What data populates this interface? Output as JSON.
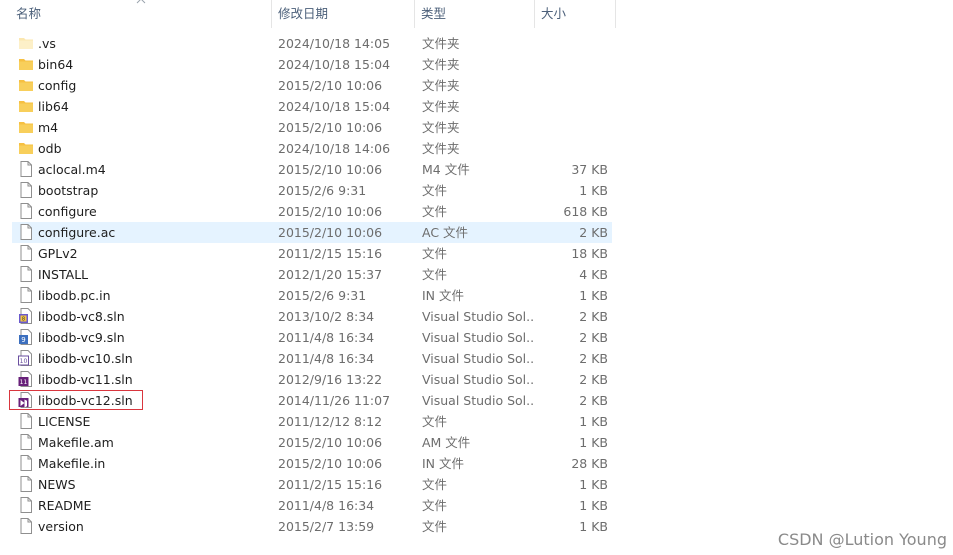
{
  "columns": {
    "name": "名称",
    "date": "修改日期",
    "type": "类型",
    "size": "大小"
  },
  "colors": {
    "header_text": "#4c607a",
    "selected_row": "#e5f3ff",
    "highlight_border": "#d9363e",
    "folder": "#f6c042"
  },
  "rows": [
    {
      "name": ".vs",
      "date": "2024/10/18 14:05",
      "type": "文件夹",
      "size": "",
      "icon": "folder-light-icon"
    },
    {
      "name": "bin64",
      "date": "2024/10/18 15:04",
      "type": "文件夹",
      "size": "",
      "icon": "folder-icon"
    },
    {
      "name": "config",
      "date": "2015/2/10 10:06",
      "type": "文件夹",
      "size": "",
      "icon": "folder-icon"
    },
    {
      "name": "lib64",
      "date": "2024/10/18 15:04",
      "type": "文件夹",
      "size": "",
      "icon": "folder-icon"
    },
    {
      "name": "m4",
      "date": "2015/2/10 10:06",
      "type": "文件夹",
      "size": "",
      "icon": "folder-icon"
    },
    {
      "name": "odb",
      "date": "2024/10/18 14:06",
      "type": "文件夹",
      "size": "",
      "icon": "folder-icon"
    },
    {
      "name": "aclocal.m4",
      "date": "2015/2/10 10:06",
      "type": "M4 文件",
      "size": "37 KB",
      "icon": "file-icon"
    },
    {
      "name": "bootstrap",
      "date": "2015/2/6 9:31",
      "type": "文件",
      "size": "1 KB",
      "icon": "file-icon"
    },
    {
      "name": "configure",
      "date": "2015/2/10 10:06",
      "type": "文件",
      "size": "618 KB",
      "icon": "file-icon"
    },
    {
      "name": "configure.ac",
      "date": "2015/2/10 10:06",
      "type": "AC 文件",
      "size": "2 KB",
      "icon": "file-icon",
      "selected": true
    },
    {
      "name": "GPLv2",
      "date": "2011/2/15 15:16",
      "type": "文件",
      "size": "18 KB",
      "icon": "file-icon"
    },
    {
      "name": "INSTALL",
      "date": "2012/1/20 15:37",
      "type": "文件",
      "size": "4 KB",
      "icon": "file-icon"
    },
    {
      "name": "libodb.pc.in",
      "date": "2015/2/6 9:31",
      "type": "IN 文件",
      "size": "1 KB",
      "icon": "file-icon"
    },
    {
      "name": "libodb-vc8.sln",
      "date": "2013/10/2 8:34",
      "type": "Visual Studio Sol...",
      "size": "2 KB",
      "icon": "vs-solution-8-icon"
    },
    {
      "name": "libodb-vc9.sln",
      "date": "2011/4/8 16:34",
      "type": "Visual Studio Sol...",
      "size": "2 KB",
      "icon": "vs-solution-9-icon"
    },
    {
      "name": "libodb-vc10.sln",
      "date": "2011/4/8 16:34",
      "type": "Visual Studio Sol...",
      "size": "2 KB",
      "icon": "vs-solution-10-icon"
    },
    {
      "name": "libodb-vc11.sln",
      "date": "2012/9/16 13:22",
      "type": "Visual Studio Sol...",
      "size": "2 KB",
      "icon": "vs-solution-11-icon"
    },
    {
      "name": "libodb-vc12.sln",
      "date": "2014/11/26 11:07",
      "type": "Visual Studio Sol...",
      "size": "2 KB",
      "icon": "vs-solution-12-icon"
    },
    {
      "name": "LICENSE",
      "date": "2011/12/12 8:12",
      "type": "文件",
      "size": "1 KB",
      "icon": "file-icon"
    },
    {
      "name": "Makefile.am",
      "date": "2015/2/10 10:06",
      "type": "AM 文件",
      "size": "1 KB",
      "icon": "file-icon"
    },
    {
      "name": "Makefile.in",
      "date": "2015/2/10 10:06",
      "type": "IN 文件",
      "size": "28 KB",
      "icon": "file-icon"
    },
    {
      "name": "NEWS",
      "date": "2011/2/15 15:16",
      "type": "文件",
      "size": "1 KB",
      "icon": "file-icon"
    },
    {
      "name": "README",
      "date": "2011/4/8 16:34",
      "type": "文件",
      "size": "1 KB",
      "icon": "file-icon"
    },
    {
      "name": "version",
      "date": "2015/2/7 13:59",
      "type": "文件",
      "size": "1 KB",
      "icon": "file-icon"
    }
  ],
  "watermark": "CSDN @Lution Young"
}
